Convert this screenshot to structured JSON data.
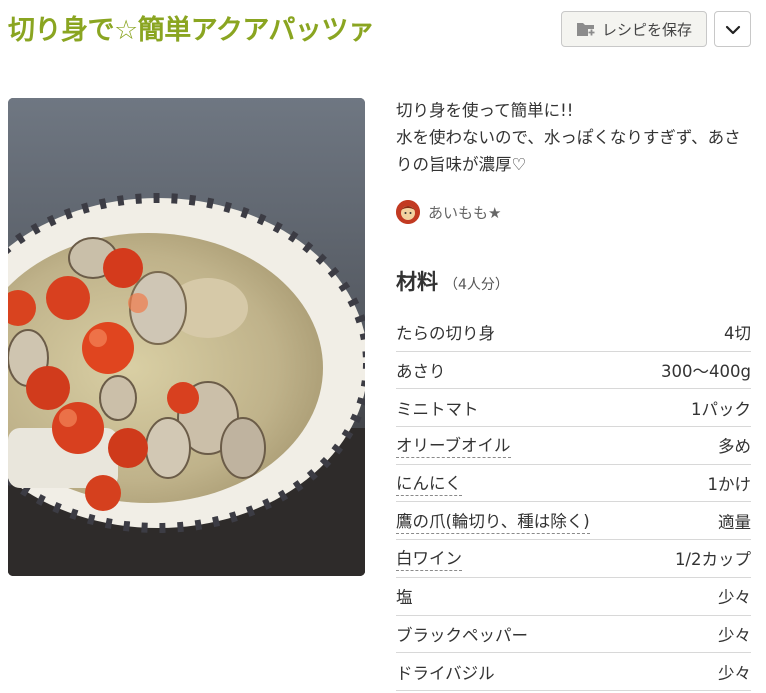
{
  "recipe": {
    "title": "切り身で☆簡単アクアパッツァ",
    "save_label": "レシピを保存",
    "description_lines": [
      "切り身を使って簡単に!!",
      "水を使わないので、水っぽくなりすぎず、あさ",
      "りの旨味が濃厚♡"
    ],
    "author": "あいもも★"
  },
  "ingredients": {
    "title": "材料",
    "servings": "（4人分）",
    "items": [
      {
        "name": "たらの切り身",
        "qty": "4切",
        "link": false
      },
      {
        "name": "あさり",
        "qty": "300〜400g",
        "link": false
      },
      {
        "name": "ミニトマト",
        "qty": "1パック",
        "link": false
      },
      {
        "name": "オリーブオイル",
        "qty": "多め",
        "link": true
      },
      {
        "name": "にんにく",
        "qty": "1かけ",
        "link": true
      },
      {
        "name": "鷹の爪(輪切り、種は除く)",
        "qty": "適量",
        "link": true
      },
      {
        "name": "白ワイン",
        "qty": "1/2カップ",
        "link": true
      },
      {
        "name": "塩",
        "qty": "少々",
        "link": false
      },
      {
        "name": "ブラックペッパー",
        "qty": "少々",
        "link": false
      },
      {
        "name": "ドライバジル",
        "qty": "少々",
        "link": false
      }
    ]
  },
  "colors": {
    "title": "#8aa521",
    "button_bg": "#f4f4f0"
  },
  "icons": {
    "save": "folder-plus-icon",
    "menu": "chevron-down-icon"
  }
}
